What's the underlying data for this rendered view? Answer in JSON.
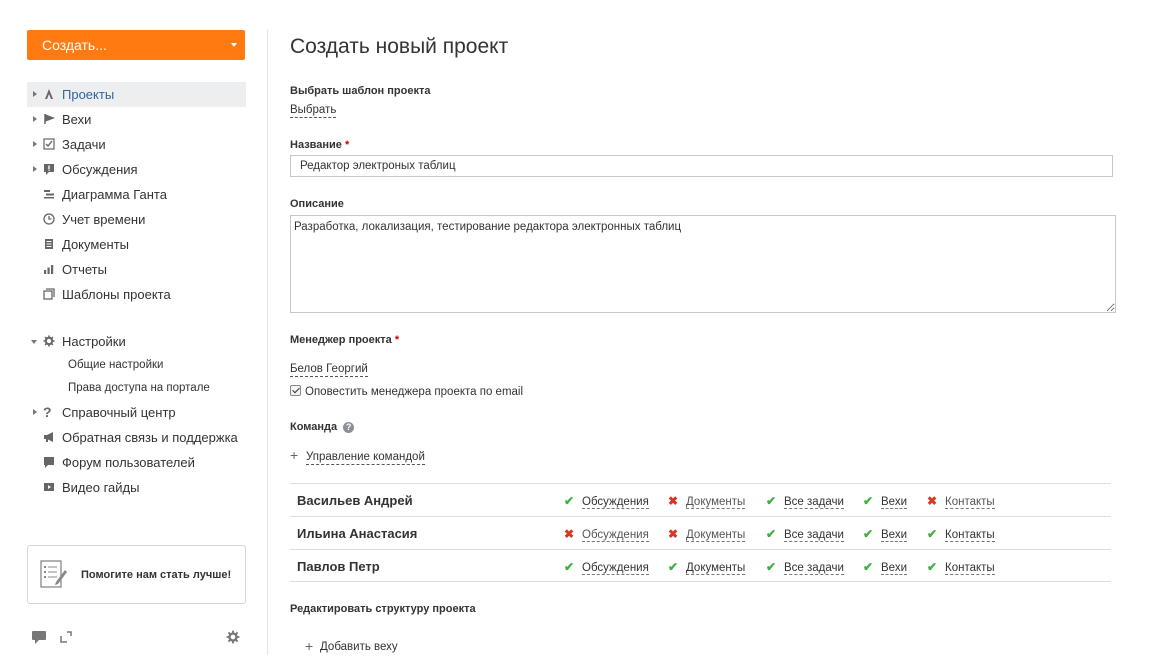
{
  "sidebar": {
    "create_label": "Создать...",
    "items": [
      {
        "label": "Проекты",
        "icon": "projects-icon",
        "arrow": "right",
        "active": true
      },
      {
        "label": "Вехи",
        "icon": "flag-icon",
        "arrow": "right"
      },
      {
        "label": "Задачи",
        "icon": "tasks-checkbox-icon",
        "arrow": "right"
      },
      {
        "label": "Обсуждения",
        "icon": "discussion-icon",
        "arrow": "right"
      },
      {
        "label": "Диаграмма Ганта",
        "icon": "gantt-icon"
      },
      {
        "label": "Учет времени",
        "icon": "clock-icon"
      },
      {
        "label": "Документы",
        "icon": "documents-icon"
      },
      {
        "label": "Отчеты",
        "icon": "reports-bar-icon"
      },
      {
        "label": "Шаблоны проекта",
        "icon": "templates-icon"
      }
    ],
    "settings": {
      "label": "Настройки",
      "sub_items": [
        "Общие настройки",
        "Права доступа на портале"
      ]
    },
    "extra_items": [
      {
        "label": "Справочный центр",
        "icon": "help-question-icon"
      },
      {
        "label": "Обратная связь и поддержка",
        "icon": "megaphone-icon"
      },
      {
        "label": "Форум пользователей",
        "icon": "forum-icon"
      },
      {
        "label": "Видео гайды",
        "icon": "video-icon"
      }
    ],
    "help_box_text": "Помогите нам стать лучше!"
  },
  "main": {
    "title": "Создать новый проект",
    "template_label": "Выбрать шаблон проекта",
    "template_link": "Выбрать",
    "name_label": "Название",
    "name_value": "Редактор электроных таблиц",
    "description_label": "Описание",
    "description_value": "Разработка, локализация, тестирование редактора электронных таблиц",
    "manager_label": "Менеджер проекта",
    "manager_value": "Белов Георгий",
    "notify_label": "Оповестить менеджера проекта по email",
    "notify_checked": true,
    "team_label": "Команда",
    "manage_team_link": "Управление командой",
    "team": [
      {
        "name": "Васильев Андрей",
        "perms": [
          {
            "label": "Обсуждения",
            "allowed": true
          },
          {
            "label": "Документы",
            "allowed": false
          },
          {
            "label": "Все задачи",
            "allowed": true
          },
          {
            "label": "Вехи",
            "allowed": true
          },
          {
            "label": "Контакты",
            "allowed": false
          }
        ]
      },
      {
        "name": "Ильина Анастасия",
        "perms": [
          {
            "label": "Обсуждения",
            "allowed": false
          },
          {
            "label": "Документы",
            "allowed": false
          },
          {
            "label": "Все задачи",
            "allowed": true
          },
          {
            "label": "Вехи",
            "allowed": true
          },
          {
            "label": "Контакты",
            "allowed": true
          }
        ]
      },
      {
        "name": "Павлов Петр",
        "perms": [
          {
            "label": "Обсуждения",
            "allowed": true
          },
          {
            "label": "Документы",
            "allowed": true
          },
          {
            "label": "Все задачи",
            "allowed": true
          },
          {
            "label": "Вехи",
            "allowed": true
          },
          {
            "label": "Контакты",
            "allowed": true
          }
        ]
      }
    ],
    "structure_label": "Редактировать структуру проекта",
    "add_milestone_link": "Добавить веху"
  },
  "colors": {
    "accent": "#ff7a10",
    "active_link": "#3462a0",
    "allowed": "#3db03d",
    "denied": "#d63a25"
  }
}
